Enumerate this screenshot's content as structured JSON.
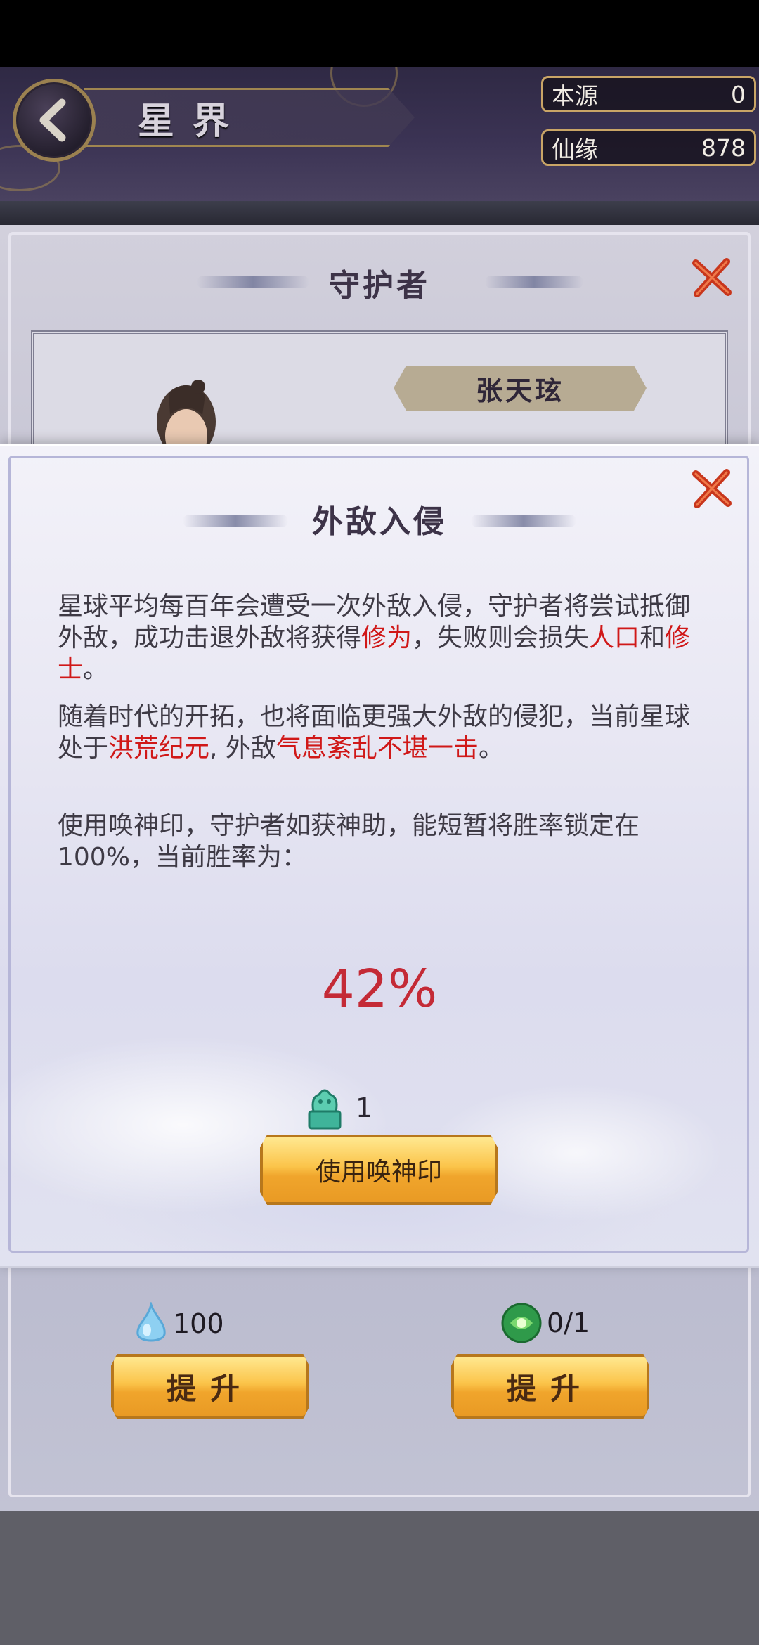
{
  "header": {
    "title": "星界",
    "resources": [
      {
        "label": "本源",
        "value": "0"
      },
      {
        "label": "仙缘",
        "value": "878"
      }
    ]
  },
  "guardian_panel": {
    "title": "守护者",
    "character_name": "张天玹"
  },
  "modal": {
    "title": "外敌入侵",
    "para1": {
      "t1": "星球平均每百年会遭受一次外敌入侵，守护者将尝试抵御外敌，成功击退外敌将获得",
      "r1": "修为",
      "t2": "，失败则会损失",
      "r2": "人口",
      "t3": "和",
      "r3": "修士",
      "t4": "。"
    },
    "para2": {
      "t1": "随着时代的开拓，也将面临更强大外敌的侵犯，当前星球处于",
      "r1": "洪荒纪元",
      "t2": ", 外敌",
      "r2": "气息紊乱不堪一击",
      "t3": "。"
    },
    "para3": "使用唤神印，守护者如获神助，能短暂将胜率锁定在100%，当前胜率为：",
    "win_rate": "42%",
    "seal_count": "1",
    "use_seal_button": "使用唤神印"
  },
  "upgrades": [
    {
      "cost": "100",
      "button": "提升"
    },
    {
      "cost": "0/1",
      "button": "提升"
    }
  ],
  "colors": {
    "accent_red": "#d01818",
    "gold_button": "#f0a52c",
    "win_rate": "#c42a36"
  }
}
